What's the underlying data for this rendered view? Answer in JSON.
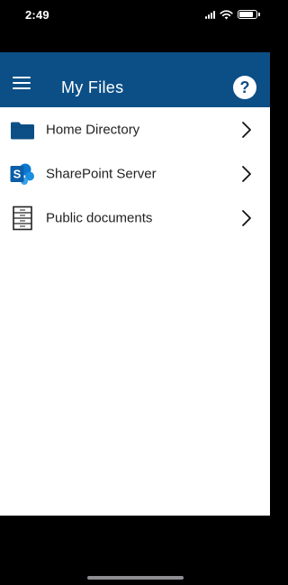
{
  "status_bar": {
    "time": "2:49"
  },
  "header": {
    "title": "My Files",
    "menu_icon": "hamburger-menu-icon",
    "help_icon": "question-mark-icon",
    "help_glyph": "?",
    "background": "#0c4f86"
  },
  "list": {
    "items": [
      {
        "label": "Home Directory",
        "icon": "folder-icon"
      },
      {
        "label": "SharePoint Server",
        "icon": "sharepoint-icon"
      },
      {
        "label": "Public documents",
        "icon": "file-cabinet-icon"
      }
    ],
    "chevron_icon": "chevron-right-icon"
  },
  "colors": {
    "accent": "#0c4f86",
    "sharepoint": "#0b78d0"
  }
}
